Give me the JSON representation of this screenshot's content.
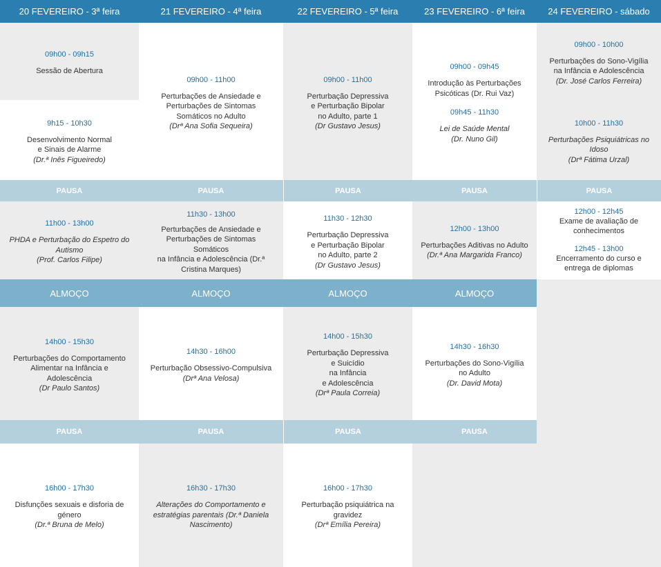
{
  "headers": [
    "20 FEVEREIRO - 3ª feira",
    "21 FEVEREIRO - 4ª feira",
    "22 FEVEREIRO - 5ª feira",
    "23 FEVEREIRO - 6ª feira",
    "24 FEVEREIRO - sábado"
  ],
  "breaks": {
    "pausa": "PAUSA",
    "almoco": "ALMOÇO"
  },
  "sessions": {
    "d1_open": {
      "time": "09h00 - 09h15",
      "title": "Sessão de Abertura"
    },
    "d1_dev": {
      "time": "9h15 - 10h30",
      "title1": "Desenvolvimento Normal",
      "title2": "e Sinais de Alarme",
      "who": "(Dr.ª Inês Figueiredo)"
    },
    "d1_phda": {
      "time": "11h00 - 13h00",
      "title1": "PHDA e Perturbação do Espetro do",
      "title2": "Autismo",
      "who": "(Prof. Carlos Filipe)"
    },
    "d1_alim": {
      "time": "14h00 - 15h30",
      "title1": "Perturbações do Comportamento",
      "title2": "Alimentar na Infância e",
      "title3": "Adolescência",
      "who": "(Dr Paulo Santos)"
    },
    "d1_sex": {
      "time": "16h00 - 17h30",
      "title1": "Disfunções sexuais e disforia de",
      "title2": "género",
      "who": "(Dr.ª Bruna de Melo)"
    },
    "d2_ans1": {
      "time": "09h00 - 11h00",
      "title1": "Perturbações de Ansiedade e",
      "title2": "Perturbações de Sintomas",
      "title3": "Somáticos no Adulto",
      "who": "(Drª Ana Sofia Sequeira)"
    },
    "d2_ans2": {
      "time": "11h30 - 13h00",
      "title1": "Perturbações de Ansiedade e",
      "title2": "Perturbações de Sintomas",
      "title3": "Somáticos",
      "title4": "na Infância e Adolescência (Dr.ª",
      "title5": "Cristina Marques)"
    },
    "d2_ocd": {
      "time": "14h30 - 16h00",
      "title1": "Perturbação Obsessivo-Compulsiva",
      "who": "(Drª Ana Velosa)"
    },
    "d2_comp": {
      "time": "16h30 - 17h30",
      "title1": "Alterações do Comportamento e",
      "title2": "estratégias parentais (Dr.ª Daniela",
      "title3": "Nascimento)"
    },
    "d3_dep1": {
      "time": "09h00 - 11h00",
      "title1": "Perturbação Depressiva",
      "title2": "e Perturbação Bipolar",
      "title3": "no Adulto, parte 1",
      "who": "(Dr Gustavo Jesus)"
    },
    "d3_dep2": {
      "time": "11h30 - 12h30",
      "title1": "Perturbação Depressiva",
      "title2": "e Perturbação Bipolar",
      "title3": "no Adulto, parte 2",
      "who": "(Dr Gustavo Jesus)"
    },
    "d3_sui": {
      "time": "14h00 - 15h30",
      "title1": "Perturbação Depressiva",
      "title2": "e Suicídio",
      "title3": "na Infância",
      "title4": "e Adolescência",
      "who": "(Drª Paula Correia)"
    },
    "d3_grav": {
      "time": "16h00 - 17h30",
      "title1": "Perturbação psiquiátrica na",
      "title2": "gravidez",
      "who": "(Drª Emília Pereira)"
    },
    "d4_psic": {
      "time": "09h00 - 09h45",
      "title1": "Introdução às Perturbações",
      "title2": "Psicóticas (Dr. Rui Vaz)"
    },
    "d4_lei": {
      "time": "09h45 - 11h30",
      "title1": "Lei de Saúde Mental",
      "who": "(Dr. Nuno Gil)"
    },
    "d4_adit": {
      "time": "12h00 - 13h00",
      "title1": "Perturbações Aditivas no Adulto",
      "who": "(Dr.ª Ana Margarida Franco)"
    },
    "d4_sono": {
      "time": "14h30 - 16h30",
      "title1": "Perturbações do Sono-Vigília",
      "title2": "no Adulto",
      "who": "(Dr. David Mota)"
    },
    "d5_sono": {
      "time": "09h00 - 10h00",
      "title1": "Perturbações do Sono-Vigília",
      "title2": "na Infância e Adolescência",
      "who": "(Dr. José Carlos Ferreira)"
    },
    "d5_psiq": {
      "time": "10h00 - 11h30",
      "title1": "Perturbações Psiquiátricas no",
      "title2": "Idoso",
      "who": "(Drª Fátima Urzal)"
    },
    "d5_exame": {
      "time": "12h00 - 12h45",
      "title1": "Exame de avaliação de",
      "title2": "conhecimentos"
    },
    "d5_encerr": {
      "time": "12h45 - 13h00",
      "title1": "Encerramento do curso e",
      "title2": "entrega de diplomas"
    }
  }
}
